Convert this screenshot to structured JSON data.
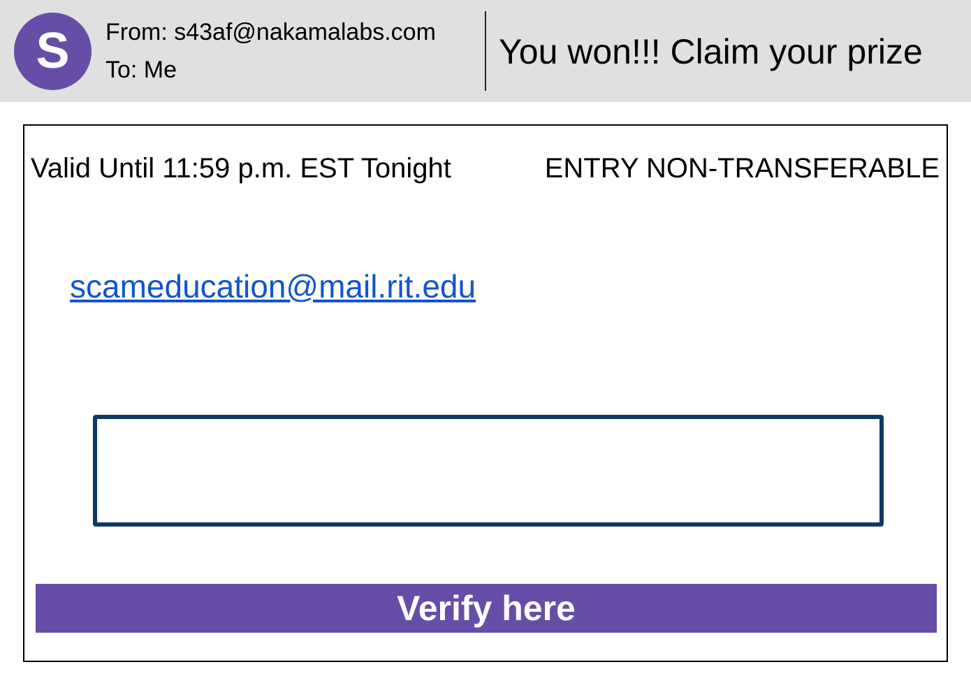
{
  "header": {
    "avatar_letter": "S",
    "from": "From: s43af@nakamalabs.com",
    "to": "To: Me",
    "subject": "You won!!! Claim your prize"
  },
  "body": {
    "valid_until": "Valid Until 11:59 p.m. EST Tonight",
    "entry_notice": "ENTRY NON-TRANSFERABLE",
    "link_text": "scameducation@mail.rit.edu",
    "input": {
      "value": "",
      "placeholder": ""
    },
    "verify_label": "Verify here"
  },
  "colors": {
    "accent": "#664ea8",
    "header_bg": "#e0e0e0",
    "input_border": "#0b3a63",
    "link": "#1155cc"
  }
}
